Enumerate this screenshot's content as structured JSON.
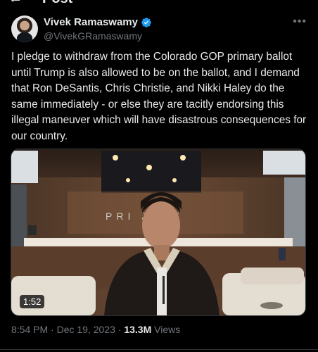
{
  "header": {
    "title": "Post",
    "back_icon": "arrow-left-icon"
  },
  "author": {
    "display_name": "Vivek Ramaswamy",
    "handle": "@VivekGRamaswamy",
    "verified": true,
    "verified_color": "#1d9bf0",
    "more_icon": "more-horizontal-icon"
  },
  "tweet": {
    "text": "I pledge to withdraw from the Colorado GOP primary ballot until Trump is also allowed to be on the ballot, and I demand that Ron DeSantis, Chris Christie, and Nikki Haley do the same immediately - or else they are tacitly endorsing this illegal maneuver which will have disastrous consequences for our country."
  },
  "media": {
    "duration": "1:52",
    "wall_sign": "PRI JECT"
  },
  "meta": {
    "time": "8:54 PM",
    "separator": "·",
    "date": "Dec 19, 2023",
    "views_count": "13.3M",
    "views_label": "Views"
  },
  "colors": {
    "background": "#000000",
    "text": "#e7e9ea",
    "secondary": "#71767b",
    "accent": "#1d9bf0"
  }
}
